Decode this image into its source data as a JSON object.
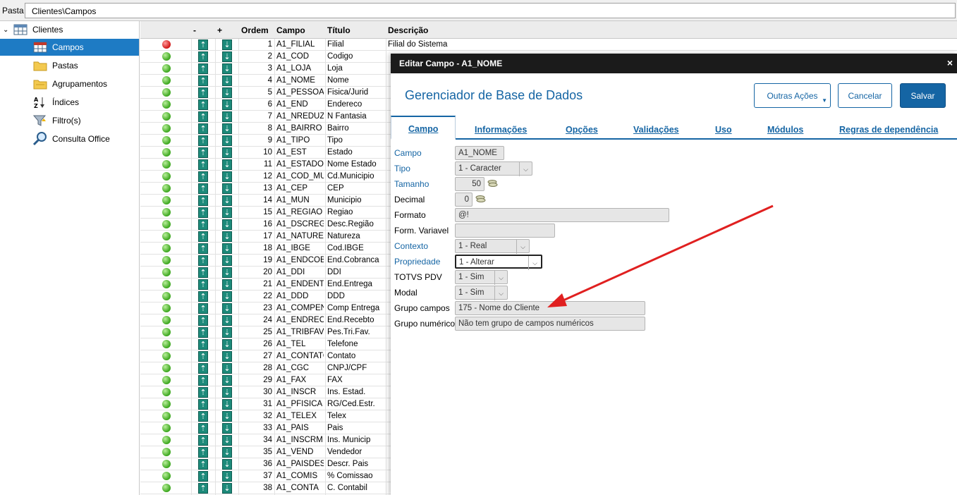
{
  "path": {
    "label": "Pasta",
    "value": "Clientes\\Campos"
  },
  "tree": {
    "root": "Clientes",
    "items": [
      {
        "label": "Campos",
        "icon": "table-icon",
        "selected": true
      },
      {
        "label": "Pastas",
        "icon": "folder-icon"
      },
      {
        "label": "Agrupamentos",
        "icon": "folder-group-icon"
      },
      {
        "label": "Índices",
        "icon": "sort-az-icon"
      },
      {
        "label": "Filtro(s)",
        "icon": "filter-icon"
      },
      {
        "label": "Consulta Office",
        "icon": "magnifier-icon"
      }
    ]
  },
  "grid": {
    "headers": {
      "minus": "-",
      "plus": "+",
      "ordem": "Ordem",
      "campo": "Campo",
      "titulo": "Título",
      "descricao": "Descrição"
    },
    "rows": [
      {
        "ordem": "1",
        "campo": "A1_FILIAL",
        "titulo": "Filial",
        "desc": "Filial do Sistema",
        "status": "red"
      },
      {
        "ordem": "2",
        "campo": "A1_COD",
        "titulo": "Codigo",
        "desc": "",
        "status": "green"
      },
      {
        "ordem": "3",
        "campo": "A1_LOJA",
        "titulo": "Loja",
        "desc": "",
        "status": "green"
      },
      {
        "ordem": "4",
        "campo": "A1_NOME",
        "titulo": "Nome",
        "desc": "",
        "status": "green"
      },
      {
        "ordem": "5",
        "campo": "A1_PESSOA",
        "titulo": "Fisica/Jurid",
        "desc": "",
        "status": "green"
      },
      {
        "ordem": "6",
        "campo": "A1_END",
        "titulo": "Endereco",
        "desc": "",
        "status": "green"
      },
      {
        "ordem": "7",
        "campo": "A1_NREDUZ",
        "titulo": "N Fantasia",
        "desc": "",
        "status": "green"
      },
      {
        "ordem": "8",
        "campo": "A1_BAIRRO",
        "titulo": "Bairro",
        "desc": "",
        "status": "green"
      },
      {
        "ordem": "9",
        "campo": "A1_TIPO",
        "titulo": "Tipo",
        "desc": "",
        "status": "green"
      },
      {
        "ordem": "10",
        "campo": "A1_EST",
        "titulo": "Estado",
        "desc": "",
        "status": "green"
      },
      {
        "ordem": "11",
        "campo": "A1_ESTADO",
        "titulo": "Nome Estado",
        "desc": "",
        "status": "green"
      },
      {
        "ordem": "12",
        "campo": "A1_COD_MU",
        "titulo": "Cd.Municipio",
        "desc": "",
        "status": "green"
      },
      {
        "ordem": "13",
        "campo": "A1_CEP",
        "titulo": "CEP",
        "desc": "",
        "status": "green"
      },
      {
        "ordem": "14",
        "campo": "A1_MUN",
        "titulo": "Municipio",
        "desc": "",
        "status": "green"
      },
      {
        "ordem": "15",
        "campo": "A1_REGIAO",
        "titulo": "Regiao",
        "desc": "",
        "status": "green"
      },
      {
        "ordem": "16",
        "campo": "A1_DSCREG",
        "titulo": "Desc.Região",
        "desc": "",
        "status": "green"
      },
      {
        "ordem": "17",
        "campo": "A1_NATURE",
        "titulo": "Natureza",
        "desc": "",
        "status": "green"
      },
      {
        "ordem": "18",
        "campo": "A1_IBGE",
        "titulo": "Cod.IBGE",
        "desc": "",
        "status": "green"
      },
      {
        "ordem": "19",
        "campo": "A1_ENDCOB",
        "titulo": "End.Cobranca",
        "desc": "",
        "status": "green"
      },
      {
        "ordem": "20",
        "campo": "A1_DDI",
        "titulo": "DDI",
        "desc": "",
        "status": "green"
      },
      {
        "ordem": "21",
        "campo": "A1_ENDENT",
        "titulo": "End.Entrega",
        "desc": "",
        "status": "green"
      },
      {
        "ordem": "22",
        "campo": "A1_DDD",
        "titulo": "DDD",
        "desc": "",
        "status": "green"
      },
      {
        "ordem": "23",
        "campo": "A1_COMPEN",
        "titulo": "Comp Entrega",
        "desc": "",
        "status": "green"
      },
      {
        "ordem": "24",
        "campo": "A1_ENDREC",
        "titulo": "End.Recebto",
        "desc": "",
        "status": "green"
      },
      {
        "ordem": "25",
        "campo": "A1_TRIBFAV",
        "titulo": "Pes.Tri.Fav.",
        "desc": "",
        "status": "green"
      },
      {
        "ordem": "26",
        "campo": "A1_TEL",
        "titulo": "Telefone",
        "desc": "",
        "status": "green"
      },
      {
        "ordem": "27",
        "campo": "A1_CONTATO",
        "titulo": "Contato",
        "desc": "",
        "status": "green"
      },
      {
        "ordem": "28",
        "campo": "A1_CGC",
        "titulo": "CNPJ/CPF",
        "desc": "",
        "status": "green"
      },
      {
        "ordem": "29",
        "campo": "A1_FAX",
        "titulo": "FAX",
        "desc": "",
        "status": "green"
      },
      {
        "ordem": "30",
        "campo": "A1_INSCR",
        "titulo": "Ins. Estad.",
        "desc": "",
        "status": "green"
      },
      {
        "ordem": "31",
        "campo": "A1_PFISICA",
        "titulo": "RG/Ced.Estr.",
        "desc": "",
        "status": "green"
      },
      {
        "ordem": "32",
        "campo": "A1_TELEX",
        "titulo": "Telex",
        "desc": "",
        "status": "green"
      },
      {
        "ordem": "33",
        "campo": "A1_PAIS",
        "titulo": "Pais",
        "desc": "",
        "status": "green"
      },
      {
        "ordem": "34",
        "campo": "A1_INSCRM",
        "titulo": "Ins. Municip",
        "desc": "",
        "status": "green"
      },
      {
        "ordem": "35",
        "campo": "A1_VEND",
        "titulo": "Vendedor",
        "desc": "",
        "status": "green"
      },
      {
        "ordem": "36",
        "campo": "A1_PAISDES",
        "titulo": "Descr. Pais",
        "desc": "",
        "status": "green"
      },
      {
        "ordem": "37",
        "campo": "A1_COMIS",
        "titulo": "% Comissao",
        "desc": "",
        "status": "green"
      },
      {
        "ordem": "38",
        "campo": "A1_CONTA",
        "titulo": "C. Contabil",
        "desc": "",
        "status": "green"
      }
    ]
  },
  "dialog": {
    "title": "Editar Campo - A1_NOME",
    "close": "×",
    "heading": "Gerenciador de Base de Dados",
    "buttons": {
      "outras": "Outras Ações",
      "cancelar": "Cancelar",
      "salvar": "Salvar"
    },
    "tabs": [
      "Campo",
      "Informações",
      "Opções",
      "Validações",
      "Uso",
      "Módulos",
      "Regras de dependência"
    ],
    "fields": [
      {
        "label": "Campo",
        "value": "A1_NOME",
        "blue": true
      },
      {
        "label": "Tipo",
        "value": "1 - Caracter",
        "blue": true,
        "select": true
      },
      {
        "label": "Tamanho",
        "value": "50",
        "blue": true,
        "coin": true
      },
      {
        "label": "Decimal",
        "value": "0",
        "blue": false,
        "coin": true
      },
      {
        "label": "Formato",
        "value": "@!",
        "blue": false
      },
      {
        "label": "Form. Variavel",
        "value": "",
        "blue": false
      },
      {
        "label": "Contexto",
        "value": "1 - Real",
        "blue": true,
        "select": true
      },
      {
        "label": "Propriedade",
        "value": "1 - Alterar",
        "blue": true,
        "select": true,
        "highlight": true
      },
      {
        "label": "TOTVS PDV",
        "value": "1 - Sim",
        "blue": false,
        "select": true
      },
      {
        "label": "Modal",
        "value": "1 - Sim",
        "blue": false,
        "select": true
      },
      {
        "label": "Grupo campos",
        "value": "175 - Nome do Cliente",
        "blue": false
      },
      {
        "label": "Grupo numérico",
        "value": "Não tem grupo de campos numéricos",
        "blue": false
      }
    ]
  },
  "colors": {
    "accent": "#1565a4",
    "selected": "#1e7bc4",
    "arrow": "#e02020",
    "teal": "#1d8a7a"
  }
}
